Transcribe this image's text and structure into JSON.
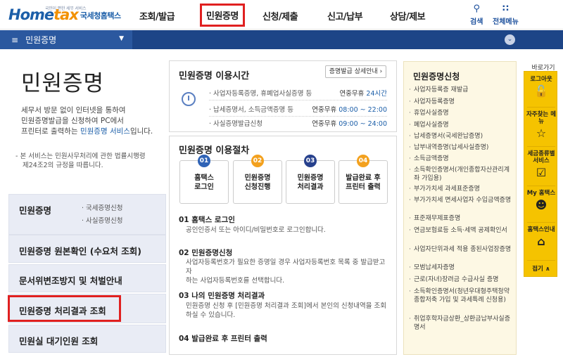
{
  "header": {
    "logo_small": "국민이 편한 세무 서비스",
    "logo_main_a": "Home",
    "logo_main_b": "tax",
    "logo_kr": "국세청홈택스",
    "nav": [
      "조회/발급",
      "민원증명",
      "신청/제출",
      "신고/납부",
      "상담/제보"
    ],
    "search": "검색",
    "all_menu": "전체메뉴"
  },
  "subbar": {
    "current": "민원증명"
  },
  "page": {
    "title": "민원증명",
    "desc_1": "세무서 방문 없이 인터넷을 통하여",
    "desc_2": "민원증명발급을 신청하여 PC에서",
    "desc_3a": "프린터로 출력하는 ",
    "desc_3b": "민원증명 서비스",
    "desc_3c": "입니다.",
    "note_1": "- 본 서비스는 민원사무처리에 관한 법률시행령",
    "note_2": "제24조2의 규정을 따릅니다."
  },
  "left_menu": {
    "m1": "민원증명",
    "m1_sub1": "· 국세증명신청",
    "m1_sub2": "· 사실증명신청",
    "m2": "민원증명 원본확인 (수요처 조회)",
    "m3": "문서위변조방지 및 처벌안내",
    "m4": "민원증명 처리결과 조회",
    "m5": "민원실 대기인원 조회"
  },
  "hours": {
    "title": "민원증명 이용시간",
    "detail_btn": "증명발급 상세안내 ›",
    "rows": [
      {
        "label": "· 사업자등록증명, 휴폐업사실증명 등",
        "val_a": "연중무휴 ",
        "val_b": "24시간"
      },
      {
        "label": "· 납세증명서, 소득금액증명 등",
        "val_a": "연중무휴 ",
        "val_b": "08:00 ~ 22:00"
      },
      {
        "label": "· 사실증명발급신청",
        "val_a": "연중무휴 ",
        "val_b": "09:00 ~ 24:00"
      }
    ]
  },
  "procedure": {
    "title": "민원증명 이용절차",
    "steps": [
      {
        "num": "01",
        "l1": "홈택스",
        "l2": "로그인"
      },
      {
        "num": "02",
        "l1": "민원증명",
        "l2": "신청진행"
      },
      {
        "num": "03",
        "l1": "민원증명",
        "l2": "처리결과"
      },
      {
        "num": "04",
        "l1": "발급완료 후",
        "l2": "프린터 출력"
      }
    ],
    "p1_title": "01 홈택스 로그인",
    "p1_desc": "공인인증서 또는 아이디/비밀번호로 로그인합니다.",
    "p2_title": "02 민원증명신청",
    "p2_desc_1": "사업자등록번호가 필요한 증명일 경우 사업자등록번호 목록 중 발급받고자",
    "p2_desc_2": "하는 사업자등록번호를 선택합니다.",
    "p3_title": "03 나의 민원증명 처리결과",
    "p3_desc_1": "민원증명 신청 후 [민원증명 처리결과 조회]에서 본인의 신청내역을 조회",
    "p3_desc_2": "하실 수 있습니다.",
    "p4_title": "04 발급완료 후 프린터 출력"
  },
  "civil": {
    "title": "민원증명신청",
    "items": [
      "사업자등록증 재발급",
      "사업자등록증명",
      "휴업사실증명",
      "폐업사실증명",
      "납세증명서(국세완납증명)",
      "납부내역증명(납세사실증명)",
      "소득금액증명",
      "소득확인증명서(개인종합자산관리계좌 가입용)",
      "부가가치세 과세표준증명",
      "부가가치세 면세사업자 수입금액증명",
      "표준재무제표증명",
      "연금보험료등 소득·세액 공제확인서",
      "사업자단위과세 적용 종된사업장증명",
      "모범납세자증명",
      "근로(자녀)장려금 수급사실 증명",
      "소득확인증명서(청년우대형주택청약종합저축 가입 및 과세특례 신청용)",
      "취업후학자금상환_상환금납부사실증명서"
    ]
  },
  "quick": {
    "title": "바로가기",
    "items": [
      "로그아웃",
      "자주찾는 메뉴",
      "세금종류별 서비스",
      "My 홈택스",
      "홈택스인내"
    ],
    "fold": "접기 ∧"
  }
}
